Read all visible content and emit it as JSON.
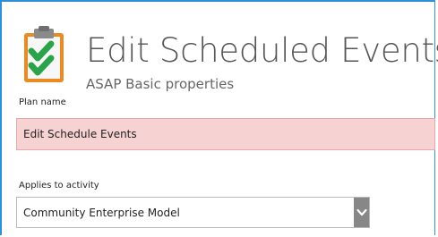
{
  "header": {
    "title": "Edit Scheduled Events",
    "subtitle": "ASAP Basic properties"
  },
  "form": {
    "plan_name": {
      "label": "Plan name",
      "value": "Edit Schedule Events"
    },
    "applies_to_activity": {
      "label": "Applies to activity",
      "selected": "Community Enterprise Model"
    }
  },
  "colors": {
    "accent_border": "#2e8fd6",
    "invalid_field_bg": "#f6d2d2",
    "icon_green": "#2aa34a",
    "icon_orange": "#e98a23"
  },
  "icons": {
    "app_icon": "clipboard-checklist-icon",
    "select_arrow": "chevron-down-icon"
  }
}
